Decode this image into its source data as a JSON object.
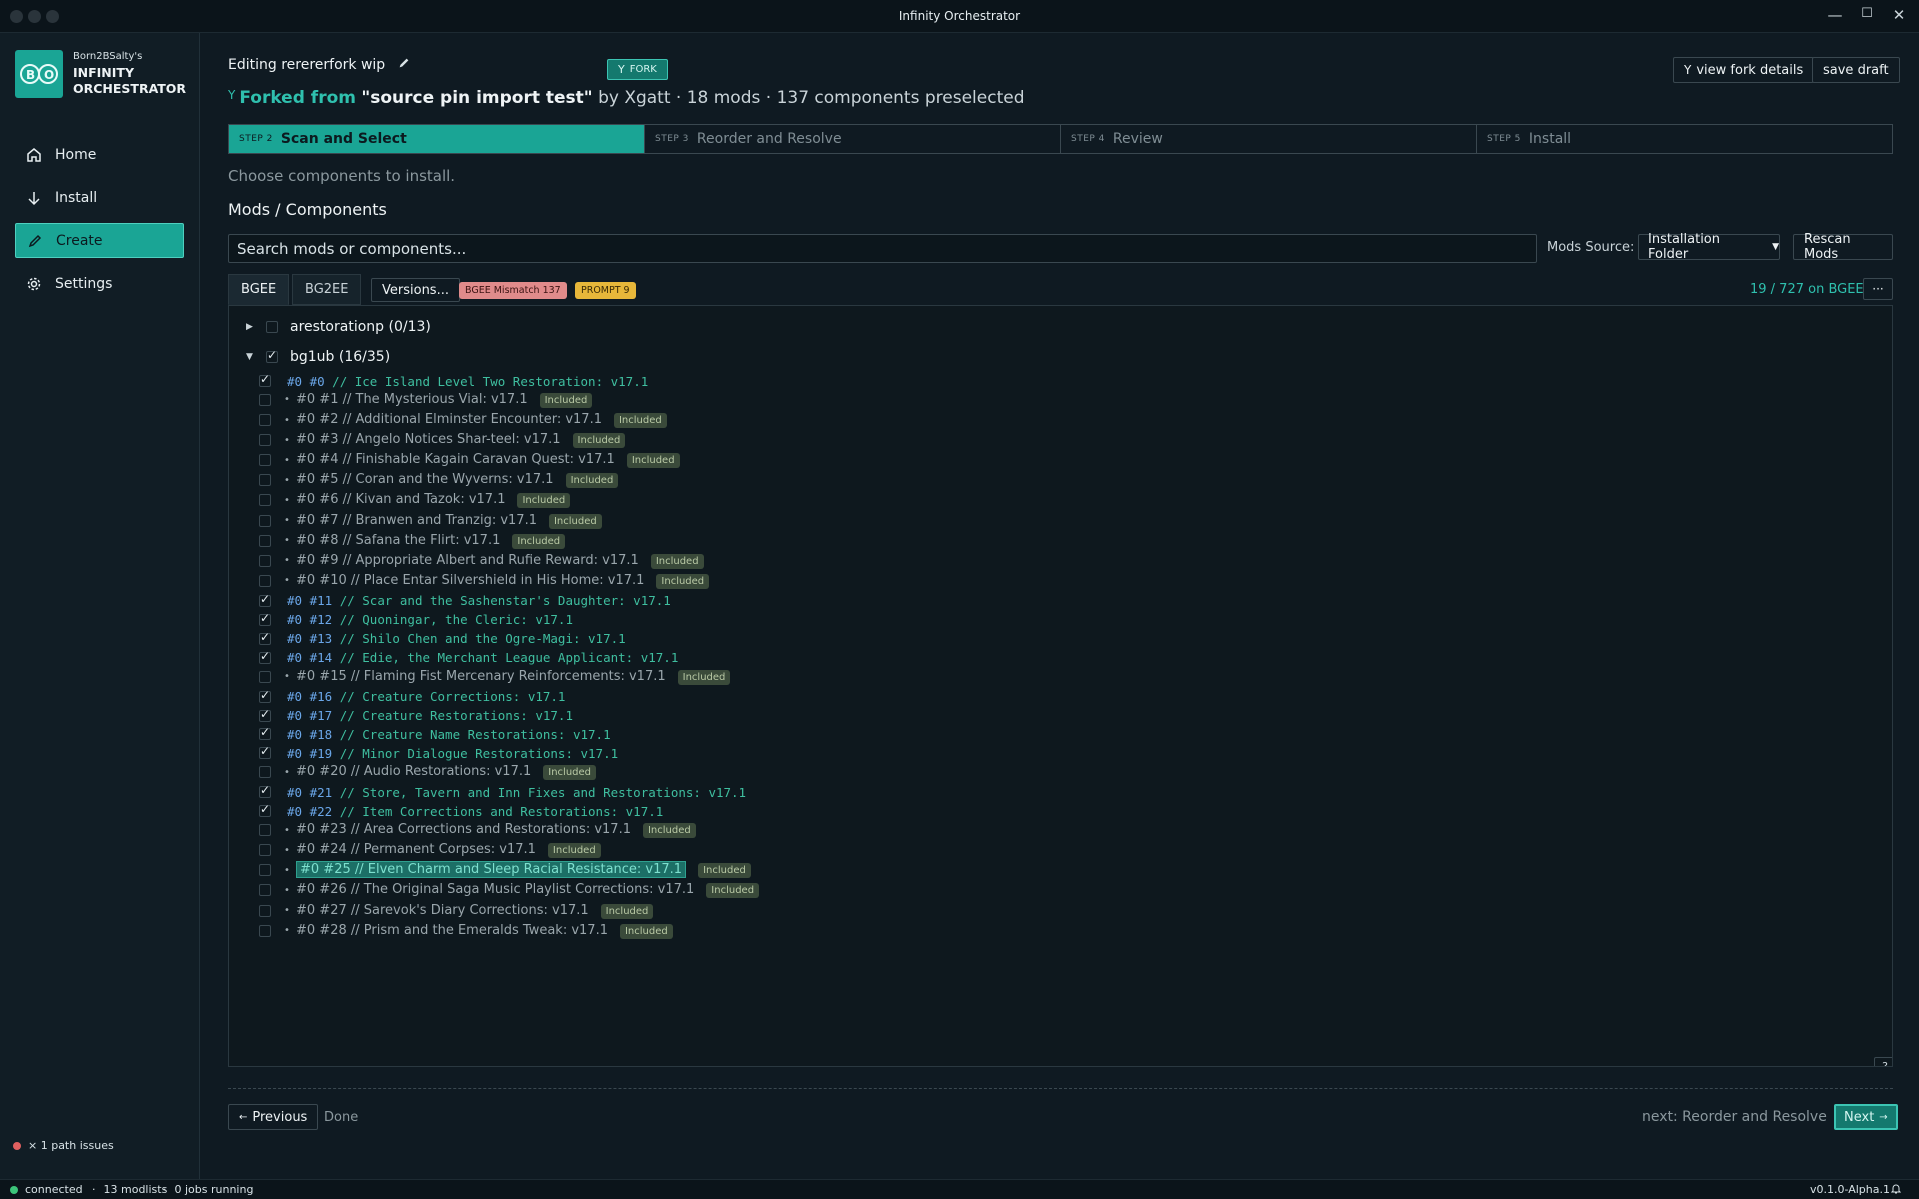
{
  "window": {
    "title": "Infinity Orchestrator"
  },
  "sidebar": {
    "brand_top": "Born2BSalty's",
    "brand_name": "INFINITY ORCHESTRATOR",
    "items": [
      {
        "label": "Home",
        "icon": "home-icon"
      },
      {
        "label": "Install",
        "icon": "download-icon"
      },
      {
        "label": "Create",
        "icon": "pencil-icon",
        "active": true
      },
      {
        "label": "Settings",
        "icon": "gear-icon"
      }
    ],
    "path_issues": "× 1 path issues"
  },
  "header": {
    "editing": "Editing rerererfork wip",
    "fork_badge": "FORK",
    "view_fork_details": "view fork details",
    "save_draft": "save draft",
    "forked_from_label": "Forked from",
    "source_name": "\"source pin import test\"",
    "forked_rest": "by Xgatt · 18 mods · 137 components preselected"
  },
  "steps": [
    {
      "num": "STEP 2",
      "label": "Scan and Select",
      "active": true
    },
    {
      "num": "STEP 3",
      "label": "Reorder and Resolve"
    },
    {
      "num": "STEP 4",
      "label": "Review"
    },
    {
      "num": "STEP 5",
      "label": "Install"
    }
  ],
  "instructions": "Choose components to install.",
  "section_title": "Mods / Components",
  "search": {
    "placeholder": "Search mods or components..."
  },
  "mods_source": {
    "label": "Mods Source:",
    "value": "Installation Folder",
    "rescan": "Rescan Mods"
  },
  "tabs": {
    "bgee": "BGEE",
    "bg2ee": "BG2EE",
    "versions": "Versions..."
  },
  "badges": {
    "mismatch": "BGEE Mismatch 137",
    "prompt": "PROMPT 9"
  },
  "count": "19 / 727 on BGEE",
  "more": "···",
  "groups": [
    {
      "label": "arestorationp (0/13)",
      "expanded": false,
      "checked": false
    },
    {
      "label": "bg1ub (16/35)",
      "expanded": true,
      "checked": true
    }
  ],
  "included_label": "Included",
  "components": [
    {
      "id": "#0 #0",
      "text": "// Ice Island Level Two Restoration: v17.1",
      "checked": true
    },
    {
      "id": "#0 #1",
      "text": "// The Mysterious Vial: v17.1",
      "checked": false
    },
    {
      "id": "#0 #2",
      "text": "// Additional Elminster Encounter: v17.1",
      "checked": false
    },
    {
      "id": "#0 #3",
      "text": "// Angelo Notices Shar-teel: v17.1",
      "checked": false
    },
    {
      "id": "#0 #4",
      "text": "// Finishable Kagain Caravan Quest: v17.1",
      "checked": false
    },
    {
      "id": "#0 #5",
      "text": "// Coran and the Wyverns: v17.1",
      "checked": false
    },
    {
      "id": "#0 #6",
      "text": "// Kivan and Tazok: v17.1",
      "checked": false
    },
    {
      "id": "#0 #7",
      "text": "// Branwen and Tranzig: v17.1",
      "checked": false
    },
    {
      "id": "#0 #8",
      "text": "// Safana the Flirt: v17.1",
      "checked": false
    },
    {
      "id": "#0 #9",
      "text": "// Appropriate Albert and Rufie Reward: v17.1",
      "checked": false
    },
    {
      "id": "#0 #10",
      "text": "// Place Entar Silvershield in His Home: v17.1",
      "checked": false
    },
    {
      "id": "#0 #11",
      "text": "// Scar and the Sashenstar's Daughter: v17.1",
      "checked": true
    },
    {
      "id": "#0 #12",
      "text": "// Quoningar, the Cleric: v17.1",
      "checked": true
    },
    {
      "id": "#0 #13",
      "text": "// Shilo Chen and the Ogre-Magi: v17.1",
      "checked": true
    },
    {
      "id": "#0 #14",
      "text": "// Edie, the Merchant League Applicant: v17.1",
      "checked": true
    },
    {
      "id": "#0 #15",
      "text": "// Flaming Fist Mercenary Reinforcements: v17.1",
      "checked": false
    },
    {
      "id": "#0 #16",
      "text": "// Creature Corrections: v17.1",
      "checked": true
    },
    {
      "id": "#0 #17",
      "text": "// Creature Restorations: v17.1",
      "checked": true
    },
    {
      "id": "#0 #18",
      "text": "// Creature Name Restorations: v17.1",
      "checked": true
    },
    {
      "id": "#0 #19",
      "text": "// Minor Dialogue Restorations: v17.1",
      "checked": true
    },
    {
      "id": "#0 #20",
      "text": "// Audio Restorations: v17.1",
      "checked": false
    },
    {
      "id": "#0 #21",
      "text": "// Store, Tavern and Inn Fixes and Restorations: v17.1",
      "checked": true
    },
    {
      "id": "#0 #22",
      "text": "// Item Corrections and Restorations: v17.1",
      "checked": true
    },
    {
      "id": "#0 #23",
      "text": "// Area Corrections and Restorations: v17.1",
      "checked": false
    },
    {
      "id": "#0 #24",
      "text": "// Permanent Corpses: v17.1",
      "checked": false
    },
    {
      "id": "#0 #25",
      "text": "// Elven Charm and Sleep Racial Resistance: v17.1",
      "checked": false,
      "highlighted": true
    },
    {
      "id": "#0 #26",
      "text": "// The Original Saga Music Playlist Corrections: v17.1",
      "checked": false
    },
    {
      "id": "#0 #27",
      "text": "// Sarevok's Diary Corrections: v17.1",
      "checked": false
    },
    {
      "id": "#0 #28",
      "text": "// Prism and the Emeralds Tweak: v17.1",
      "checked": false
    }
  ],
  "help": "?",
  "footer": {
    "previous": "Previous",
    "done": "Done",
    "next_label": "next: Reorder and Resolve",
    "next_btn": "Next"
  },
  "status": {
    "connected": "connected",
    "modlists": "13 modlists",
    "jobs": "0 jobs running",
    "version": "v0.1.0-Alpha.1"
  },
  "colors": {
    "accent": "#1aa595",
    "background": "#0f1a22",
    "checked_text": "#3fbfa0",
    "component_id": "#6aa6e8",
    "error_dot": "#e06060",
    "ok_dot": "#3cc47a"
  }
}
